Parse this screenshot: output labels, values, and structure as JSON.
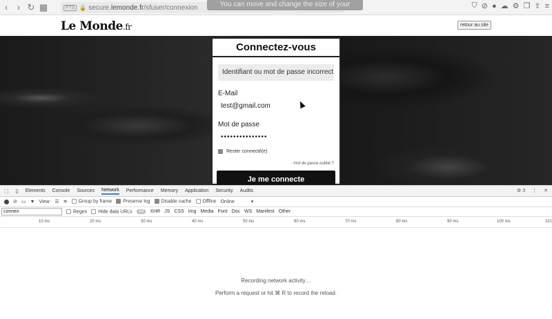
{
  "browser": {
    "url_badge": "FTS",
    "url_prefix": "secure.",
    "url_domain": "lemonde.fr",
    "url_path": "/sfuser/connexion",
    "selection_hint": "You can move and change the size of your selection"
  },
  "header": {
    "logo": "Le Monde",
    "logo_tld": ".fr",
    "back_link": "retour au site"
  },
  "login": {
    "title": "Connectez-vous",
    "error": "Identifiant ou mot de passe incorrect",
    "email_label": "E-Mail",
    "email_value": "test@gmail.com",
    "password_label": "Mot de passe",
    "password_value": "•••••••••••••••",
    "remember_label": "Rester connecté(e)",
    "forgot_link": "· mot de passe oublié ?",
    "submit": "Je me connecte"
  },
  "devtools": {
    "tabs": [
      "Elements",
      "Console",
      "Sources",
      "Network",
      "Performance",
      "Memory",
      "Application",
      "Security",
      "Audits"
    ],
    "active_tab": "Network",
    "counter": "3",
    "toolbar": {
      "view_label": "View:",
      "group_by_frame": "Group by frame",
      "preserve_log": "Preserve log",
      "disable_cache": "Disable cache",
      "offline": "Offline",
      "throttle": "Online"
    },
    "filter": {
      "value": "connex",
      "regex": "Regex",
      "hide_data_urls": "Hide data URLs",
      "types": [
        "All",
        "XHR",
        "JS",
        "CSS",
        "Img",
        "Media",
        "Font",
        "Doc",
        "WS",
        "Manifest",
        "Other"
      ]
    },
    "timeline_ticks": [
      "10 ms",
      "20 ms",
      "30 ms",
      "40 ms",
      "50 ms",
      "60 ms",
      "70 ms",
      "80 ms",
      "90 ms",
      "100 ms",
      "110"
    ],
    "message_line1": "Recording network activity…",
    "message_line2": "Perform a request or hit ⌘ R to record the reload."
  }
}
